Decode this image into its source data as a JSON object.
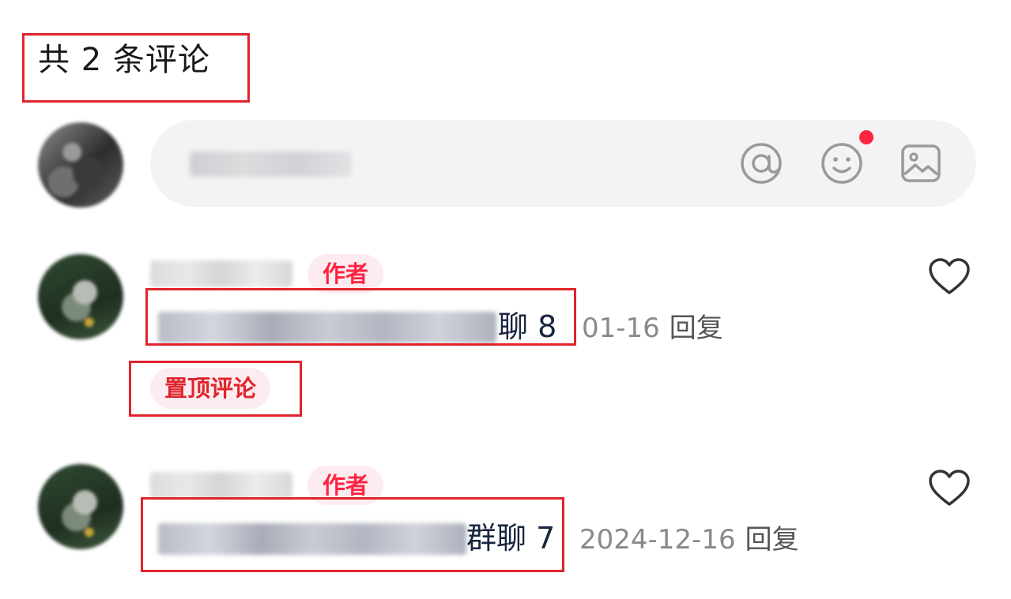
{
  "header": {
    "count_label": "共 2 条评论"
  },
  "composer": {
    "placeholder": "说点什么...",
    "icons": [
      "at-icon",
      "emoji-icon",
      "image-icon"
    ],
    "notification_dot_color": "#ff2442"
  },
  "colors": {
    "accent": "#ff2442",
    "annotation_box": "#e0242c"
  },
  "comments": [
    {
      "author_badge": "作者",
      "text_visible_tail": "聊 8",
      "date": "01-16",
      "reply_label": "回复",
      "pinned_label": "置顶评论"
    },
    {
      "author_badge": "作者",
      "text_visible_tail": "群聊 7",
      "date": "2024-12-16",
      "reply_label": "回复"
    }
  ]
}
